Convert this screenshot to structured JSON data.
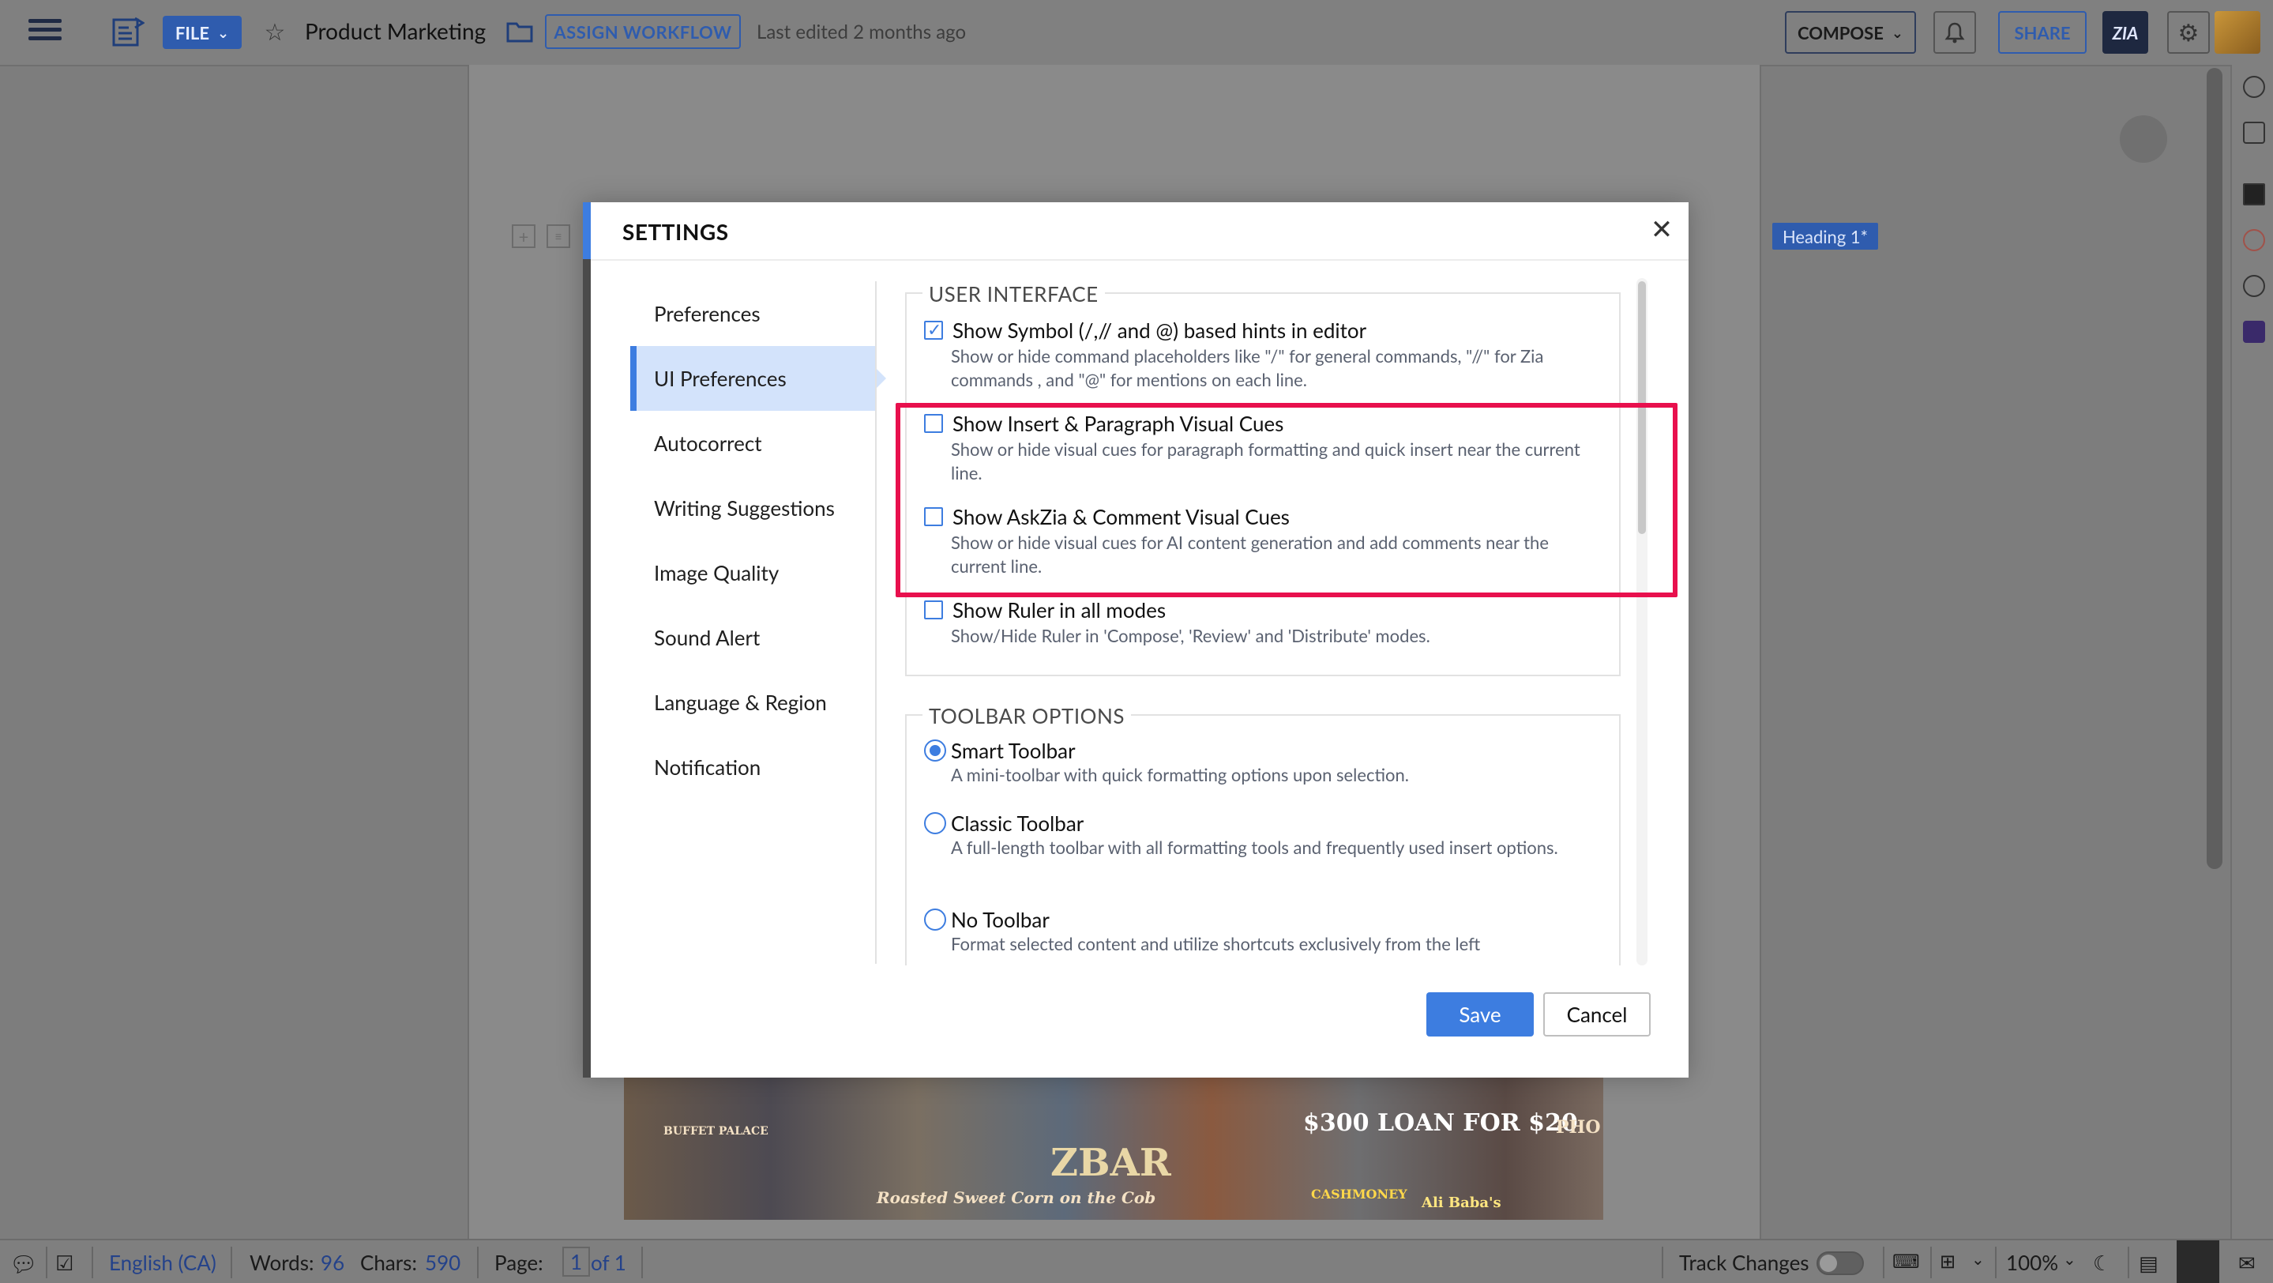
{
  "topbar": {
    "file_label": "FILE",
    "doc_title": "Product Marketing",
    "assign_workflow": "ASSIGN WORKFLOW",
    "last_edited": "Last edited 2 months ago",
    "compose_label": "COMPOSE",
    "share_label": "SHARE",
    "zia_label": "ZIA"
  },
  "document": {
    "heading_tag": "Heading 1*",
    "image_signs": [
      "BUFFET PALACE",
      "Roasted Sweet Corn on the Cob",
      "ZBAR",
      "$300 LOAN FOR $20",
      "CASHMONEY",
      "Ali Baba's",
      "PHO"
    ]
  },
  "settings": {
    "title": "SETTINGS",
    "nav": [
      {
        "label": "Preferences"
      },
      {
        "label": "UI Preferences"
      },
      {
        "label": "Autocorrect"
      },
      {
        "label": "Writing Suggestions"
      },
      {
        "label": "Image Quality"
      },
      {
        "label": "Sound Alert"
      },
      {
        "label": "Language & Region"
      },
      {
        "label": "Notification"
      }
    ],
    "active_nav": "UI Preferences",
    "user_interface": {
      "legend": "USER INTERFACE",
      "options": [
        {
          "title": "Show Symbol (/,// and @) based hints in editor",
          "desc": "Show or hide command placeholders like \"/\" for general commands, \"//\" for Zia commands , and \"@\" for mentions on each line.",
          "checked": true
        },
        {
          "title": "Show Insert & Paragraph Visual Cues",
          "desc": "Show or hide visual cues for paragraph formatting and quick insert near the current line.",
          "checked": false
        },
        {
          "title": "Show AskZia & Comment Visual Cues",
          "desc": "Show or hide visual cues for AI content generation and add comments near the current line.",
          "checked": false
        },
        {
          "title": "Show Ruler in all modes",
          "desc": "Show/Hide Ruler in 'Compose', 'Review' and 'Distribute' modes.",
          "checked": false
        }
      ]
    },
    "toolbar_options": {
      "legend": "TOOLBAR OPTIONS",
      "options": [
        {
          "title": "Smart Toolbar",
          "desc": "A mini-toolbar with quick formatting options upon selection.",
          "selected": true
        },
        {
          "title": "Classic Toolbar",
          "desc": "A full-length toolbar with all formatting tools and frequently used insert options.",
          "selected": false
        },
        {
          "title": "No Toolbar",
          "desc": "Format selected content and utilize shortcuts exclusively from the left",
          "selected": false
        }
      ]
    },
    "save_label": "Save",
    "cancel_label": "Cancel"
  },
  "statusbar": {
    "language": "English (CA)",
    "words_label": "Words:",
    "words_value": "96",
    "chars_label": "Chars:",
    "chars_value": "590",
    "page_label": "Page:",
    "page_current": "1",
    "page_total": "of 1",
    "track_changes": "Track Changes",
    "zoom": "100%"
  },
  "colors": {
    "accent": "#3d7de0",
    "highlight": "#e8104d",
    "brand_blue": "#2f5cae"
  }
}
